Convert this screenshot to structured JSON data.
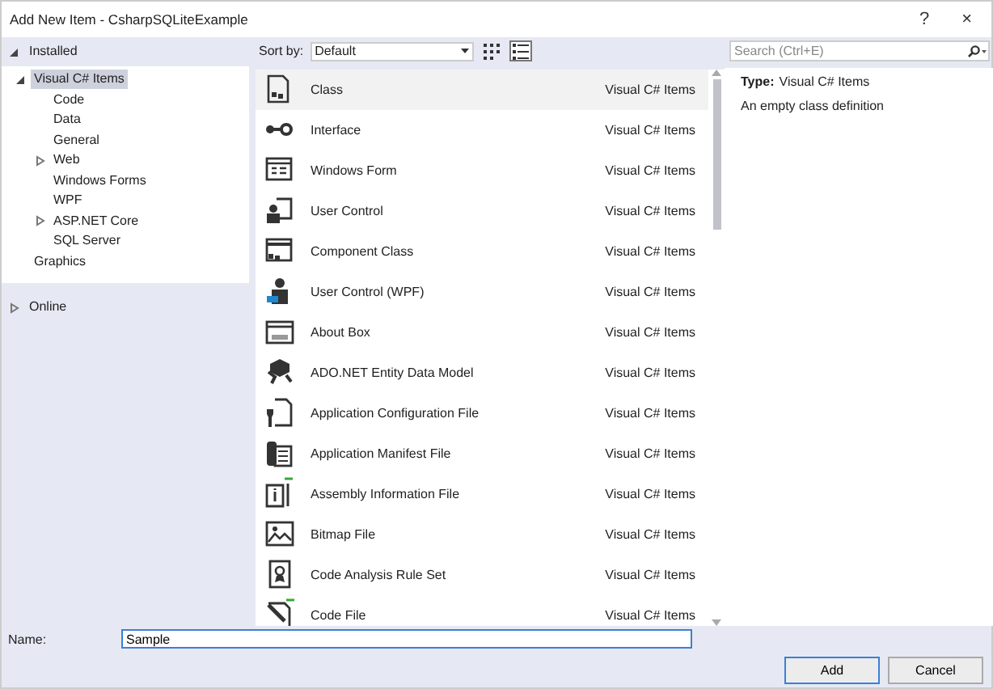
{
  "window": {
    "title": "Add New Item - CsharpSQLiteExample",
    "help": "?",
    "close": "×"
  },
  "sidebar": {
    "header": {
      "label": "Installed",
      "expanded": true
    },
    "tree": [
      {
        "label": "Visual C# Items",
        "selected": true,
        "expanded": true,
        "children": [
          {
            "label": "Code",
            "selected": false
          },
          {
            "label": "Data",
            "selected": false
          },
          {
            "label": "General",
            "selected": false
          },
          {
            "label": "Web",
            "selected": false,
            "expanded": false
          },
          {
            "label": "Windows Forms",
            "selected": false
          },
          {
            "label": "WPF",
            "selected": false
          },
          {
            "label": "ASP.NET Core",
            "selected": false,
            "expanded": false
          },
          {
            "label": "SQL Server",
            "selected": false
          }
        ]
      },
      {
        "label": "Graphics",
        "selected": false
      }
    ],
    "online": {
      "label": "Online",
      "expanded": false
    }
  },
  "toolbar": {
    "sort_label": "Sort by:",
    "sort_value": "Default",
    "views": [
      {
        "kind": "grid",
        "selected": false
      },
      {
        "kind": "list",
        "selected": true
      }
    ]
  },
  "search": {
    "placeholder": "Search (Ctrl+E)"
  },
  "items": [
    {
      "name": "Class",
      "category": "Visual C# Items",
      "selected": true
    },
    {
      "name": "Interface",
      "category": "Visual C# Items",
      "selected": false
    },
    {
      "name": "Windows Form",
      "category": "Visual C# Items",
      "selected": false
    },
    {
      "name": "User Control",
      "category": "Visual C# Items",
      "selected": false
    },
    {
      "name": "Component Class",
      "category": "Visual C# Items",
      "selected": false
    },
    {
      "name": "User Control (WPF)",
      "category": "Visual C# Items",
      "selected": false
    },
    {
      "name": "About Box",
      "category": "Visual C# Items",
      "selected": false
    },
    {
      "name": "ADO.NET Entity Data Model",
      "category": "Visual C# Items",
      "selected": false
    },
    {
      "name": "Application Configuration File",
      "category": "Visual C# Items",
      "selected": false
    },
    {
      "name": "Application Manifest File",
      "category": "Visual C# Items",
      "selected": false
    },
    {
      "name": "Assembly Information File",
      "category": "Visual C# Items",
      "selected": false
    },
    {
      "name": "Bitmap File",
      "category": "Visual C# Items",
      "selected": false
    },
    {
      "name": "Code Analysis Rule Set",
      "category": "Visual C# Items",
      "selected": false
    },
    {
      "name": "Code File",
      "category": "Visual C# Items",
      "selected": false
    }
  ],
  "details": {
    "type_label": "Type:",
    "type_value": "Visual C# Items",
    "description": "An empty class definition"
  },
  "footer": {
    "name_label": "Name:",
    "name_value": "Sample",
    "buttons": [
      {
        "label": "Add",
        "kind": "primary"
      },
      {
        "label": "Cancel",
        "kind": "normal"
      }
    ]
  }
}
